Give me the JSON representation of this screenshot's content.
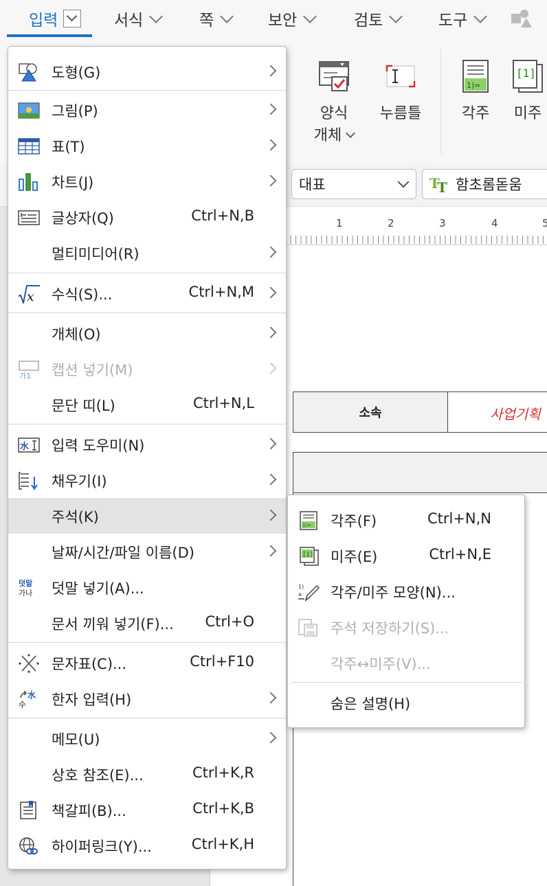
{
  "menubar": {
    "tabs": [
      {
        "label": "입력"
      },
      {
        "label": "서식"
      },
      {
        "label": "쪽"
      },
      {
        "label": "보안"
      },
      {
        "label": "검토"
      },
      {
        "label": "도구"
      }
    ]
  },
  "ribbon": {
    "form_object": {
      "line1": "양식",
      "line2": "개체"
    },
    "stamp": "누름틀",
    "footnote": "각주",
    "endnote": "미주",
    "style_combo": "대표",
    "font_combo": "함초롬돋움"
  },
  "ruler": {
    "marks": [
      "1",
      "2",
      "3",
      "4",
      "5"
    ]
  },
  "document": {
    "cell_label": "소속",
    "cell_value": "사업기획"
  },
  "main_menu": {
    "items": [
      {
        "label": "도형(G)",
        "shortcut": "",
        "submenu": true,
        "icon": "shape-icon"
      },
      {
        "label": "그림(P)",
        "shortcut": "",
        "submenu": true,
        "icon": "picture-icon"
      },
      {
        "label": "표(T)",
        "shortcut": "",
        "submenu": true,
        "icon": "table-icon"
      },
      {
        "label": "차트(J)",
        "shortcut": "",
        "submenu": true,
        "icon": "chart-icon"
      },
      {
        "label": "글상자(Q)",
        "shortcut": "Ctrl+N,B",
        "submenu": false,
        "icon": "textbox-icon"
      },
      {
        "label": "멀티미디어(R)",
        "shortcut": "",
        "submenu": true,
        "icon": ""
      },
      {
        "label": "수식(S)...",
        "shortcut": "Ctrl+N,M",
        "submenu": true,
        "icon": "formula-icon"
      },
      {
        "label": "개체(O)",
        "shortcut": "",
        "submenu": true,
        "icon": ""
      },
      {
        "label": "캡션 넣기(M)",
        "shortcut": "",
        "submenu": true,
        "icon": "caption-icon",
        "disabled": true
      },
      {
        "label": "문단 띠(L)",
        "shortcut": "Ctrl+N,L",
        "submenu": false,
        "icon": ""
      },
      {
        "label": "입력 도우미(N)",
        "shortcut": "",
        "submenu": true,
        "icon": "input-helper-icon"
      },
      {
        "label": "채우기(I)",
        "shortcut": "",
        "submenu": true,
        "icon": "fill-icon"
      },
      {
        "label": "주석(K)",
        "shortcut": "",
        "submenu": true,
        "icon": "",
        "highlighted": true
      },
      {
        "label": "날짜/시간/파일 이름(D)",
        "shortcut": "",
        "submenu": true,
        "icon": ""
      },
      {
        "label": "덧말 넣기(A)...",
        "shortcut": "",
        "submenu": false,
        "icon": "ruby-icon"
      },
      {
        "label": "문서 끼워 넣기(F)...",
        "shortcut": "Ctrl+O",
        "submenu": false,
        "icon": ""
      },
      {
        "label": "문자표(C)...",
        "shortcut": "Ctrl+F10",
        "submenu": false,
        "icon": "symbol-icon"
      },
      {
        "label": "한자 입력(H)",
        "shortcut": "",
        "submenu": true,
        "icon": "hanja-icon"
      },
      {
        "label": "메모(U)",
        "shortcut": "",
        "submenu": true,
        "icon": ""
      },
      {
        "label": "상호 참조(E)...",
        "shortcut": "Ctrl+K,R",
        "submenu": false,
        "icon": ""
      },
      {
        "label": "책갈피(B)...",
        "shortcut": "Ctrl+K,B",
        "submenu": false,
        "icon": "bookmark-icon"
      },
      {
        "label": "하이퍼링크(Y)...",
        "shortcut": "Ctrl+K,H",
        "submenu": false,
        "icon": "hyperlink-icon"
      }
    ]
  },
  "sub_menu": {
    "items": [
      {
        "label": "각주(F)",
        "shortcut": "Ctrl+N,N",
        "icon": "footnote-icon"
      },
      {
        "label": "미주(E)",
        "shortcut": "Ctrl+N,E",
        "icon": "endnote-icon"
      },
      {
        "label": "각주/미주 모양(N)...",
        "shortcut": "",
        "icon": "note-format-icon"
      },
      {
        "label": "주석 저장하기(S)...",
        "shortcut": "",
        "icon": "save-note-icon",
        "disabled": true
      },
      {
        "label": "각주↔미주(V)...",
        "shortcut": "",
        "icon": "",
        "disabled": true
      },
      {
        "label": "숨은 설명(H)",
        "shortcut": "",
        "icon": ""
      }
    ]
  },
  "colors": {
    "accent": "#1a73c8",
    "highlight": "#e3e3e3",
    "red_text": "#d83030"
  }
}
